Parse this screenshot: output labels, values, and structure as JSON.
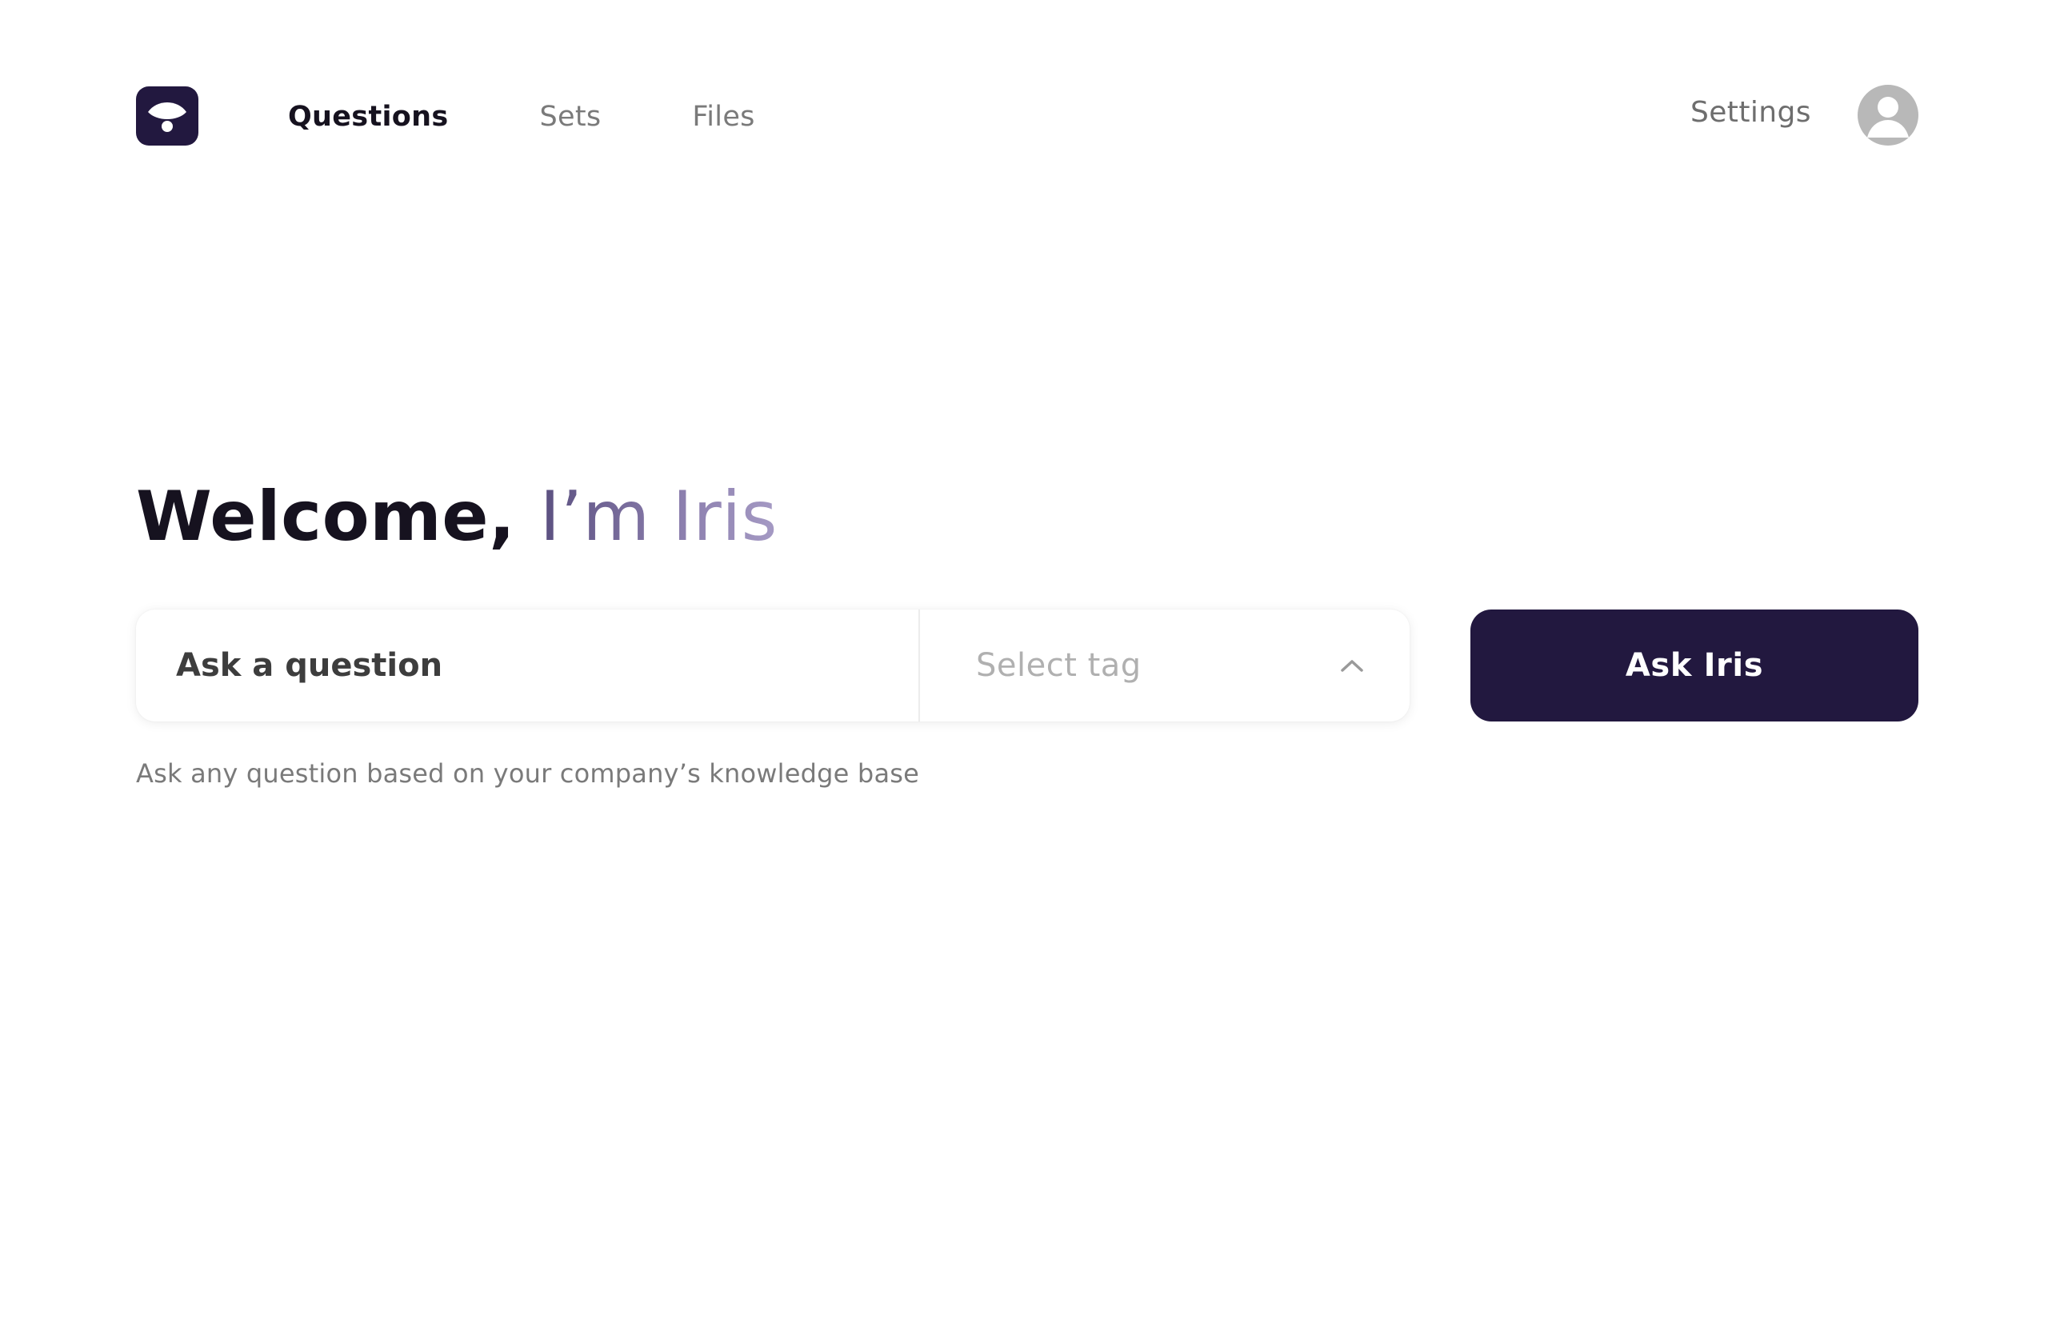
{
  "app": {
    "logo_icon": "iris-eye-logo-icon",
    "brand_color": "#22183f"
  },
  "nav": {
    "items": [
      {
        "label": "Questions",
        "active": true
      },
      {
        "label": "Sets",
        "active": false
      },
      {
        "label": "Files",
        "active": false
      }
    ],
    "settings_label": "Settings",
    "avatar_icon": "user-avatar-icon"
  },
  "main": {
    "welcome_prefix": "Welcome, ",
    "welcome_name": "I’m Iris",
    "question_placeholder": "Ask a question",
    "question_value": "",
    "tag_placeholder": "Select tag",
    "tag_chevron_icon": "chevron-up-icon",
    "ask_button_label": "Ask Iris",
    "helper_text": "Ask any question based on your company’s knowledge base"
  },
  "colors": {
    "accent": "#22183f",
    "gradient_start": "#5b5080",
    "gradient_end": "#a59ac4",
    "muted_text": "#7a7a7a"
  }
}
